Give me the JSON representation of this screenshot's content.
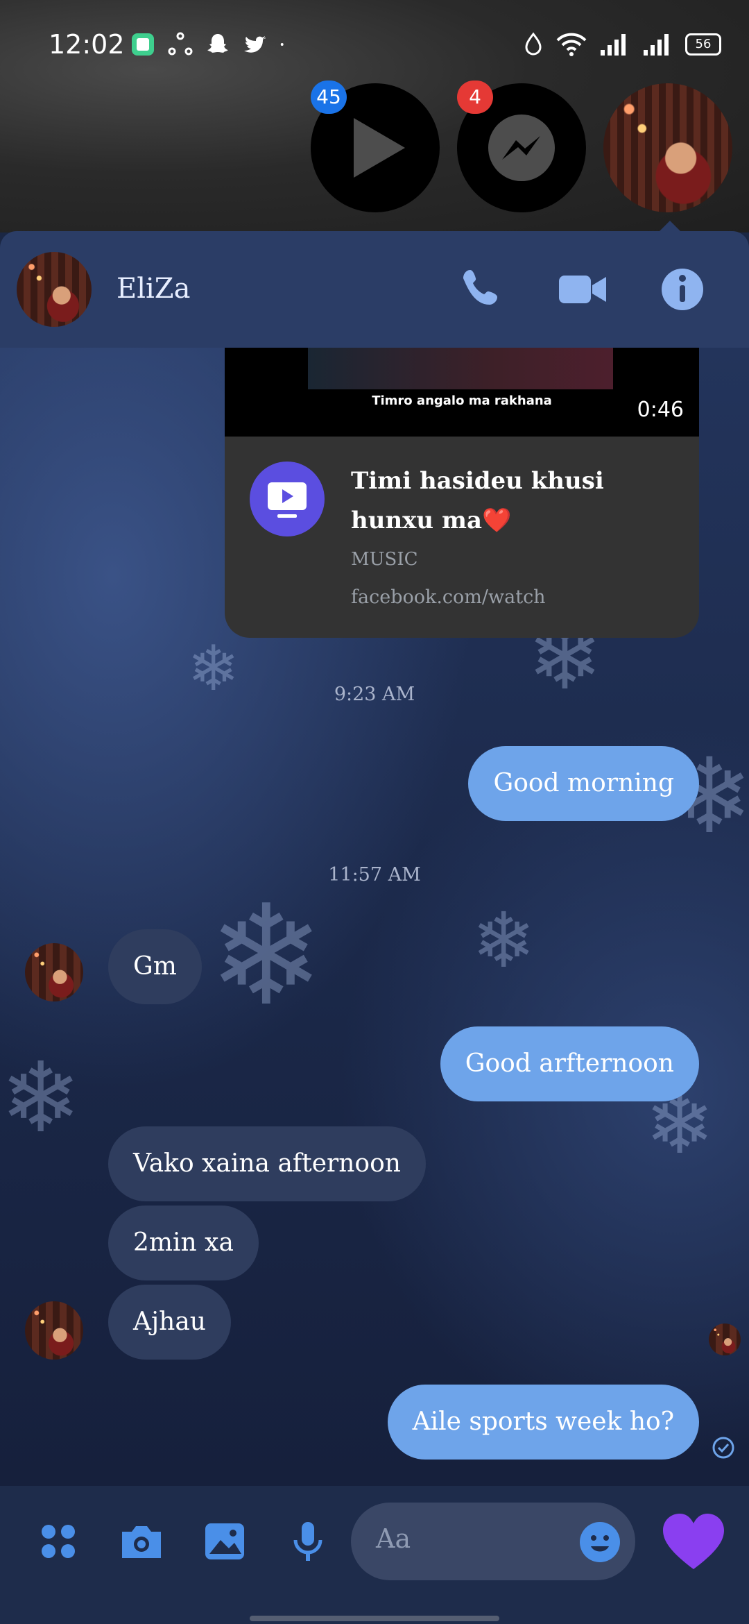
{
  "status": {
    "time": "12:02",
    "battery": "56",
    "icons": [
      "gallery-app-icon",
      "share-icon",
      "snapchat-icon",
      "twitter-icon",
      "dot-icon",
      "data-saver-icon",
      "wifi-icon",
      "signal-icon",
      "signal-icon"
    ]
  },
  "chat_heads": [
    {
      "name": "video-app",
      "badge": "45",
      "badge_color": "#1a73e8"
    },
    {
      "name": "messenger",
      "badge": "4",
      "badge_color": "#e53935"
    },
    {
      "name": "eliza-avatar"
    }
  ],
  "header": {
    "name": "EliZa",
    "actions": [
      "phone-icon",
      "video-camera-icon",
      "info-icon"
    ],
    "accent": "#8fb4f0"
  },
  "shared_video": {
    "caption": "Timro angalo ma rakhana",
    "duration": "0:46",
    "title": "Timi hasideu khusi hunxu ma❤️",
    "category": "MUSIC",
    "url": "facebook.com/watch"
  },
  "messages": [
    {
      "type": "timestamp",
      "text": "9:23 AM"
    },
    {
      "type": "outgoing",
      "text": "Good morning"
    },
    {
      "type": "timestamp",
      "text": "11:57 AM"
    },
    {
      "type": "incoming",
      "text": "Gm"
    },
    {
      "type": "outgoing",
      "text": "Good arfternoon"
    },
    {
      "type": "incoming",
      "text": "Vako xaina afternoon"
    },
    {
      "type": "incoming",
      "text": "2min xa"
    },
    {
      "type": "incoming",
      "text": "Ajhau"
    },
    {
      "type": "outgoing",
      "text": "Aile sports week ho?"
    }
  ],
  "composer": {
    "placeholder": "Aa",
    "buttons": [
      "apps-icon",
      "camera-icon",
      "gallery-icon",
      "microphone-icon",
      "emoji-icon",
      "heart-icon"
    ],
    "heart_color": "#8a3ff0"
  }
}
